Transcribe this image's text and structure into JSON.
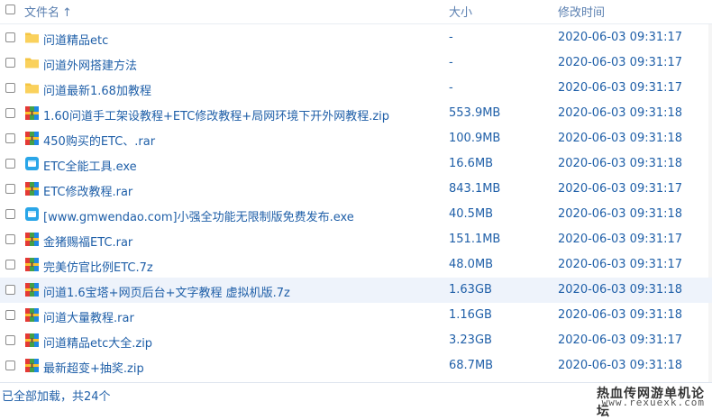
{
  "header": {
    "name_label": "文件名",
    "sort_arrow": "↑",
    "size_label": "大小",
    "time_label": "修改时间"
  },
  "icons": {
    "folder": "folder-icon",
    "archive": "archive-icon",
    "exe": "exe-icon"
  },
  "colors": {
    "link": "#1f5fa8",
    "folder": "#f5c542",
    "exe": "#2aa6e8",
    "row_hover": "#eef3fb"
  },
  "files": [
    {
      "name": "问道精品etc",
      "size": "-",
      "time": "2020-06-03 09:31:17",
      "type": "folder"
    },
    {
      "name": "问道外网搭建方法",
      "size": "-",
      "time": "2020-06-03 09:31:17",
      "type": "folder"
    },
    {
      "name": "问道最新1.68加教程",
      "size": "-",
      "time": "2020-06-03 09:31:17",
      "type": "folder"
    },
    {
      "name": "1.60问道手工架设教程+ETC修改教程+局网环境下开外网教程.zip",
      "size": "553.9MB",
      "time": "2020-06-03 09:31:18",
      "type": "archive"
    },
    {
      "name": "450购买的ETC、.rar",
      "size": "100.9MB",
      "time": "2020-06-03 09:31:18",
      "type": "archive"
    },
    {
      "name": "ETC全能工具.exe",
      "size": "16.6MB",
      "time": "2020-06-03 09:31:18",
      "type": "exe"
    },
    {
      "name": "ETC修改教程.rar",
      "size": "843.1MB",
      "time": "2020-06-03 09:31:17",
      "type": "archive"
    },
    {
      "name": "[www.gmwendao.com]小强全功能无限制版免费发布.exe",
      "size": "40.5MB",
      "time": "2020-06-03 09:31:18",
      "type": "exe"
    },
    {
      "name": "金猪赐福ETC.rar",
      "size": "151.1MB",
      "time": "2020-06-03 09:31:17",
      "type": "archive"
    },
    {
      "name": "完美仿官比例ETC.7z",
      "size": "48.0MB",
      "time": "2020-06-03 09:31:17",
      "type": "archive"
    },
    {
      "name": "问道1.6宝塔+网页后台+文字教程 虚拟机版.7z",
      "size": "1.63GB",
      "time": "2020-06-03 09:31:18",
      "type": "archive",
      "hover": true
    },
    {
      "name": "问道大量教程.rar",
      "size": "1.16GB",
      "time": "2020-06-03 09:31:18",
      "type": "archive"
    },
    {
      "name": "问道精品etc大全.zip",
      "size": "3.23GB",
      "time": "2020-06-03 09:31:17",
      "type": "archive"
    },
    {
      "name": "最新超变+抽奖.zip",
      "size": "68.7MB",
      "time": "2020-06-03 09:31:18",
      "type": "archive"
    }
  ],
  "footer": {
    "status": "已全部加载，共24个",
    "watermark_line1": "热血传网游单机论坛",
    "watermark_line2": "www.rexuexk.com"
  }
}
